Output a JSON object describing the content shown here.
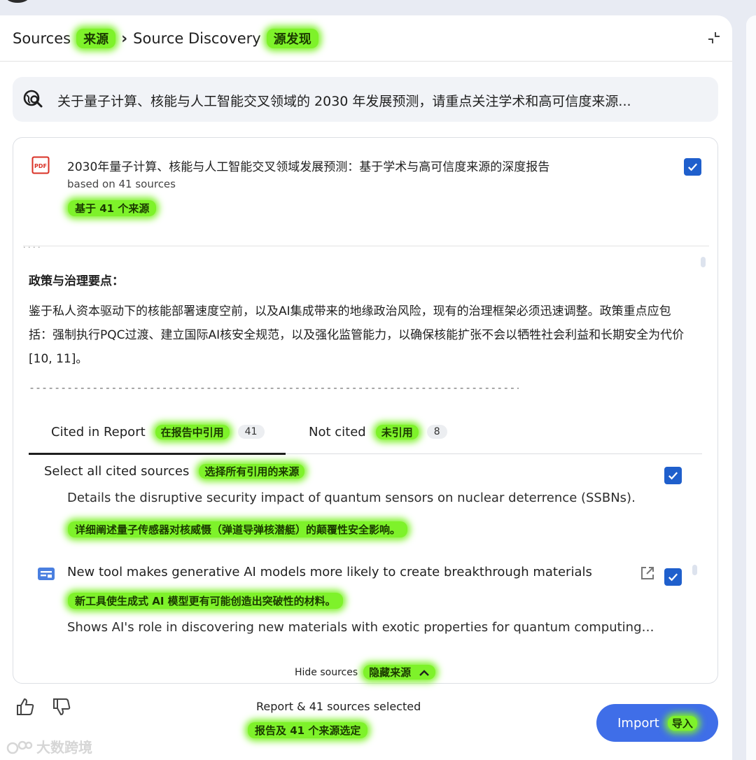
{
  "breadcrumb": {
    "root": "Sources",
    "root_cn": "来源",
    "current": "Source Discovery",
    "current_cn": "源发现"
  },
  "search": {
    "query": "关于量子计算、核能与人工智能交叉领域的 2030 年发展预测，请重点关注学术和高可信度来源..."
  },
  "report": {
    "title": "2030年量子计算、核能与人工智能交叉领域发展预测：基于学术与高可信度来源的深度报告",
    "sources_label": "based on 41 sources",
    "sources_label_cn": "基于 41 个来源",
    "checked": true
  },
  "preview": {
    "fragment": "· · · ·",
    "heading": "政策与治理要点：",
    "body": "鉴于私人资本驱动下的核能部署速度空前，以及AI集成带来的地缘政治风险，现有的治理框架必须迅速调整。政策重点应包括：强制执行PQC过渡、建立国际AI核安全规范，以及强化监管能力，以确保核能扩张不会以牺牲社会利益和长期安全为代价 [10, 11]。",
    "separator": "------------------------------------------------------------------------------"
  },
  "tabs": [
    {
      "label": "Cited in Report",
      "label_cn": "在报告中引用",
      "count": "41",
      "active": true
    },
    {
      "label": "Not cited",
      "label_cn": "未引用",
      "count": "8",
      "active": false
    }
  ],
  "select_all": {
    "label": "Select all cited sources",
    "label_cn": "选择所有引用的来源",
    "checked": true
  },
  "sources": [
    {
      "description": "Details the disruptive security impact of quantum sensors on nuclear deterrence (SSBNs).",
      "description_cn": "详细阐述量子传感器对核威慑（弹道导弹核潜艇）的颠覆性安全影响。"
    },
    {
      "icon": "article-icon",
      "title": "New tool makes generative AI models more likely to create breakthrough materials",
      "title_cn": "新工具使生成式 AI 模型更有可能创造出突破性的材料。",
      "description": "Shows AI's role in discovering new materials with exotic properties for quantum computing appli...",
      "checked": true
    }
  ],
  "hide_sources": {
    "label": "Hide sources",
    "label_cn": "隐藏来源"
  },
  "footer": {
    "selected": "Report & 41 sources selected",
    "selected_cn": "报告及 41 个来源选定",
    "import_label": "Import",
    "import_label_cn": "导入"
  },
  "watermark": "大数跨境",
  "colors": {
    "accent": "#1f5fcc",
    "import_button": "#3f6ee8",
    "highlight": "#7ef22a",
    "pdf_red": "#d93025"
  }
}
